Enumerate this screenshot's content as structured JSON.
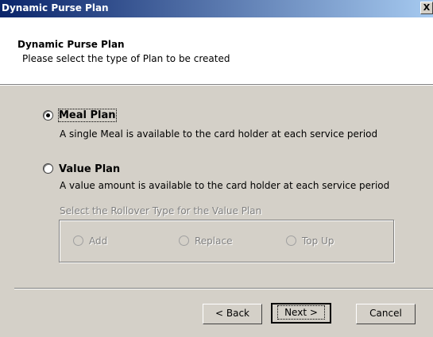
{
  "window": {
    "title": "Dynamic Purse Plan",
    "close_glyph": "X"
  },
  "header": {
    "title": "Dynamic Purse Plan",
    "subtitle": "Please select the type of Plan to be created"
  },
  "options": {
    "meal": {
      "label": "Meal Plan",
      "description": "A single Meal is available to the card holder at each service period",
      "selected": true
    },
    "value": {
      "label": "Value Plan",
      "description": "A value amount is available to the card holder at each service period",
      "selected": false
    }
  },
  "rollover": {
    "caption": "Select the Rollover Type for the Value Plan",
    "add": "Add",
    "replace": "Replace",
    "topup": "Top Up"
  },
  "buttons": {
    "back": "< Back",
    "next": "Next >",
    "cancel": "Cancel"
  },
  "colors": {
    "title_start": "#0a246a",
    "title_end": "#a6caf0",
    "dialog_bg": "#d4d0c8"
  }
}
